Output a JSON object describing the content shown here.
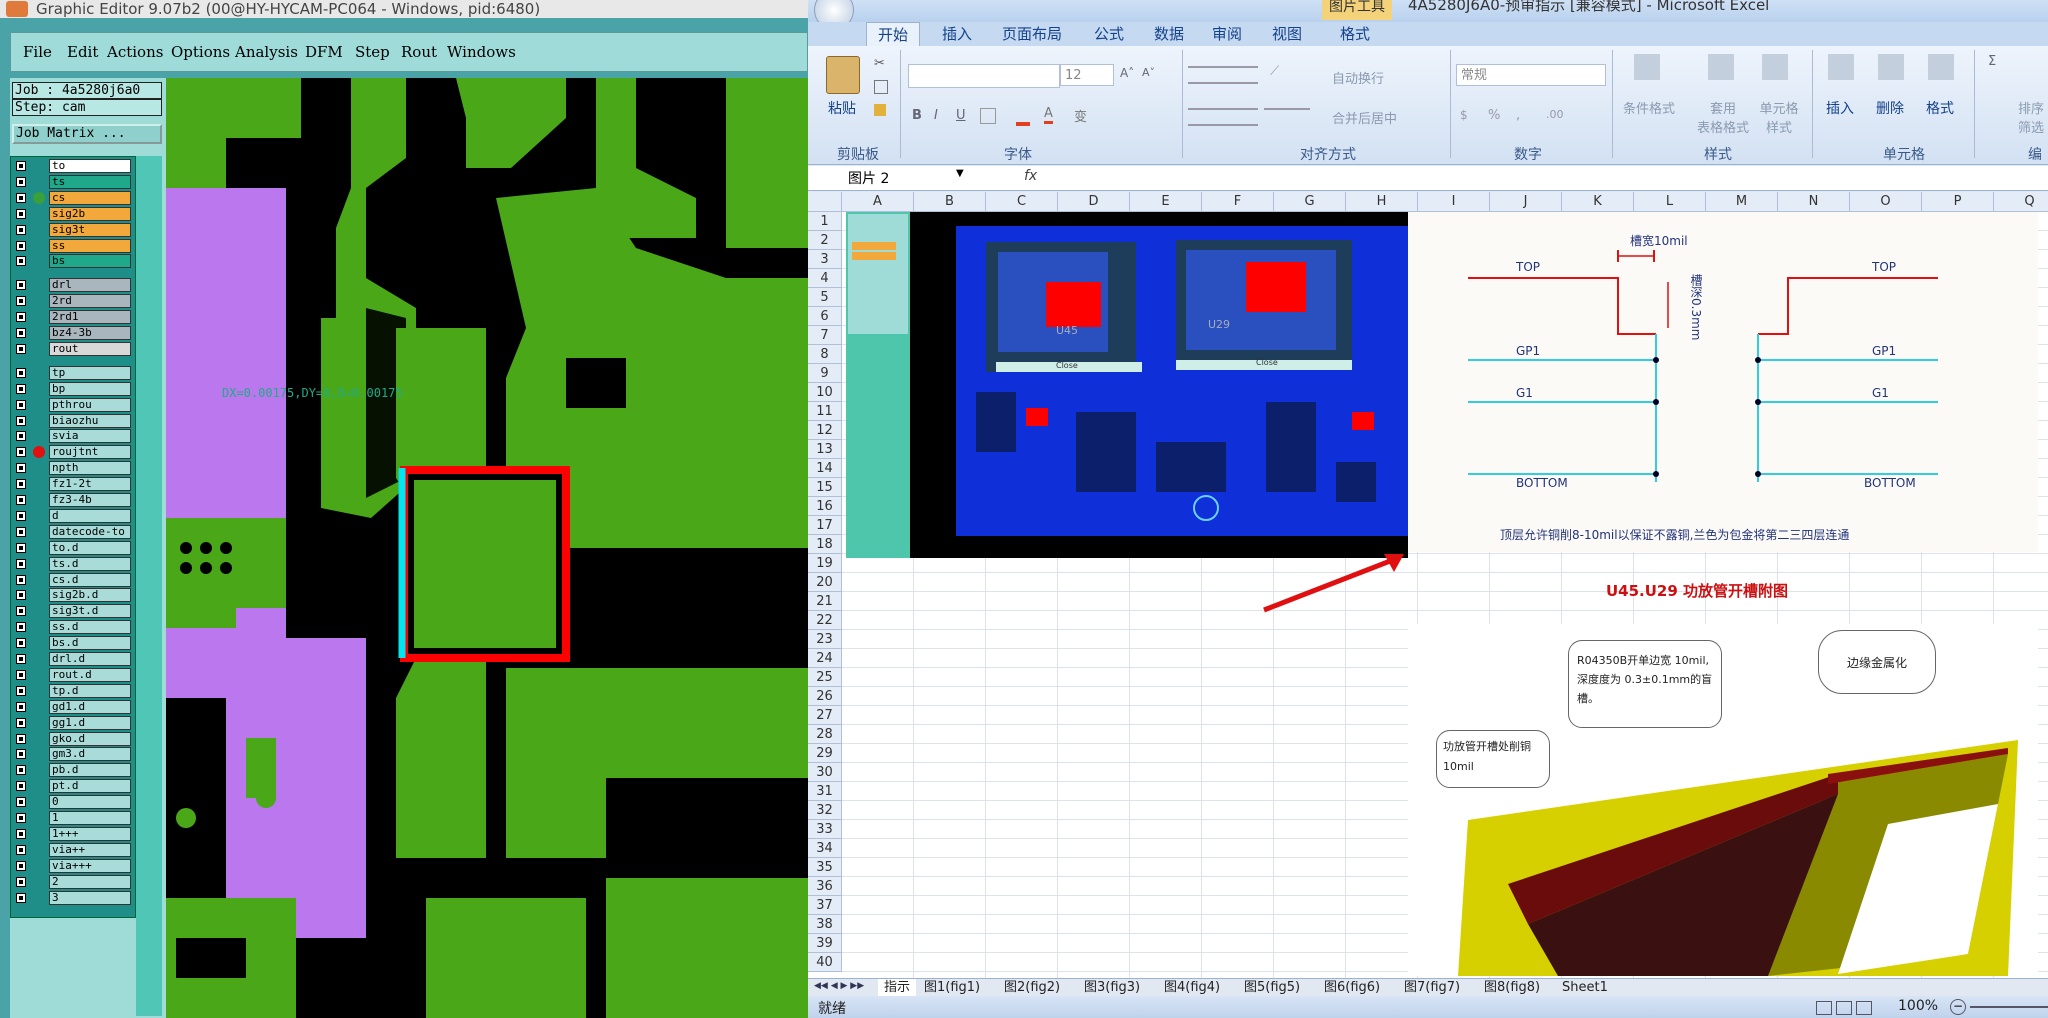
{
  "genesis": {
    "title": "Graphic Editor 9.07b2 (00@HY-HYCAM-PC064 - Windows, pid:6480)",
    "menu": [
      "File",
      "Edit",
      "Actions",
      "Options",
      "Analysis",
      "DFM",
      "Step",
      "Rout",
      "Windows"
    ],
    "job_label": "Job : 4a5280j6a0",
    "step_label": "Step: cam",
    "job_matrix_button": "Job Matrix ...",
    "layers": [
      {
        "name": "to",
        "color": "#ffffff"
      },
      {
        "name": "ts",
        "color": "#1fa88a"
      },
      {
        "name": "cs",
        "color": "#f2a83a",
        "dot": "#3aa03a"
      },
      {
        "name": "sig2b",
        "color": "#f2a83a"
      },
      {
        "name": "sig3t",
        "color": "#f2a83a"
      },
      {
        "name": "ss",
        "color": "#f2a83a"
      },
      {
        "name": "bs",
        "color": "#1fa88a"
      },
      {
        "name": "drl",
        "color": "#a9b6bd"
      },
      {
        "name": "2rd",
        "color": "#a9b6bd"
      },
      {
        "name": "2rd1",
        "color": "#a9b6bd"
      },
      {
        "name": "bz4-3b",
        "color": "#a9b6bd"
      },
      {
        "name": "rout",
        "color": "#d8d8d8"
      },
      {
        "name": "tp"
      },
      {
        "name": "bp"
      },
      {
        "name": "pthrou"
      },
      {
        "name": "biaozhu"
      },
      {
        "name": "svia"
      },
      {
        "name": "roujtnt",
        "dot": "#e01010"
      },
      {
        "name": "npth"
      },
      {
        "name": "fz1-2t"
      },
      {
        "name": "fz3-4b"
      },
      {
        "name": "d"
      },
      {
        "name": "datecode-to"
      },
      {
        "name": "to.d"
      },
      {
        "name": "ts.d"
      },
      {
        "name": "cs.d"
      },
      {
        "name": "sig2b.d"
      },
      {
        "name": "sig3t.d"
      },
      {
        "name": "ss.d"
      },
      {
        "name": "bs.d"
      },
      {
        "name": "drl.d"
      },
      {
        "name": "rout.d"
      },
      {
        "name": "tp.d"
      },
      {
        "name": "gd1.d"
      },
      {
        "name": "gg1.d"
      },
      {
        "name": "gko.d"
      },
      {
        "name": "gm3.d"
      },
      {
        "name": "pb.d"
      },
      {
        "name": "pt.d"
      },
      {
        "name": "0"
      },
      {
        "name": "1"
      },
      {
        "name": "1+++"
      },
      {
        "name": "via++"
      },
      {
        "name": "via+++"
      },
      {
        "name": "2"
      },
      {
        "name": "3"
      }
    ],
    "measure_text": "DX=0.00175,DY=0,D=0.00175"
  },
  "excel": {
    "title": "4A5280J6A0-预审指示 [兼容模式] - Microsoft Excel",
    "picture_tools": "图片工具",
    "tabs": [
      "开始",
      "插入",
      "页面布局",
      "公式",
      "数据",
      "审阅",
      "视图",
      "格式"
    ],
    "ribbon": {
      "paste": "粘贴",
      "clipboard": "剪贴板",
      "font_name": "",
      "font_size": "12",
      "font_group": "字体",
      "wrap": "自动换行",
      "merge": "合并后居中",
      "align_group": "对齐方式",
      "number_format": "常规",
      "number_group": "数字",
      "cond_format": "条件格式",
      "table_format": "套用\n表格格式",
      "cell_style": "单元格\n样式",
      "style_group": "样式",
      "insert": "插入",
      "delete": "删除",
      "format": "格式",
      "cells_group": "单元格",
      "sort": "排序\n筛选",
      "edit_group": "编"
    },
    "name_box": "图片 2",
    "fx": "fx",
    "columns": [
      "A",
      "B",
      "C",
      "D",
      "E",
      "F",
      "G",
      "H",
      "I",
      "J",
      "K",
      "L",
      "M",
      "N",
      "O",
      "P",
      "Q"
    ],
    "rows": 40,
    "diagram": {
      "slot_width": "槽宽10mil",
      "depth": "槽深0.3mm",
      "top": "TOP",
      "gp1": "GP1",
      "g1": "G1",
      "bottom": "BOTTOM",
      "note": "顶层允许铜削8-10mil以保证不露铜,兰色为包金将第二三四层连通",
      "caption": "U45.U29 功放管开槽附图",
      "inner_cols": [
        "A",
        "B",
        "C",
        "D",
        "E",
        "F",
        "G",
        "H",
        "I"
      ]
    },
    "callouts": {
      "c1": "R04350B开单边宽 10mil,深度度为 0.3±0.1mm的盲槽。",
      "c2": "边缘金属化",
      "c3": "功放管开槽处削铜 10mil"
    },
    "screenshot_labels": [
      "U45",
      "U29",
      "Close",
      "Close"
    ],
    "sheet_tabs": [
      "指示",
      "图1(fig1)",
      "图2(fig2)",
      "图3(fig3)",
      "图4(fig4)",
      "图5(fig5)",
      "图6(fig6)",
      "图7(fig7)",
      "图8(fig8)",
      "Sheet1"
    ],
    "status_ready": "就绪",
    "zoom": "100%"
  }
}
